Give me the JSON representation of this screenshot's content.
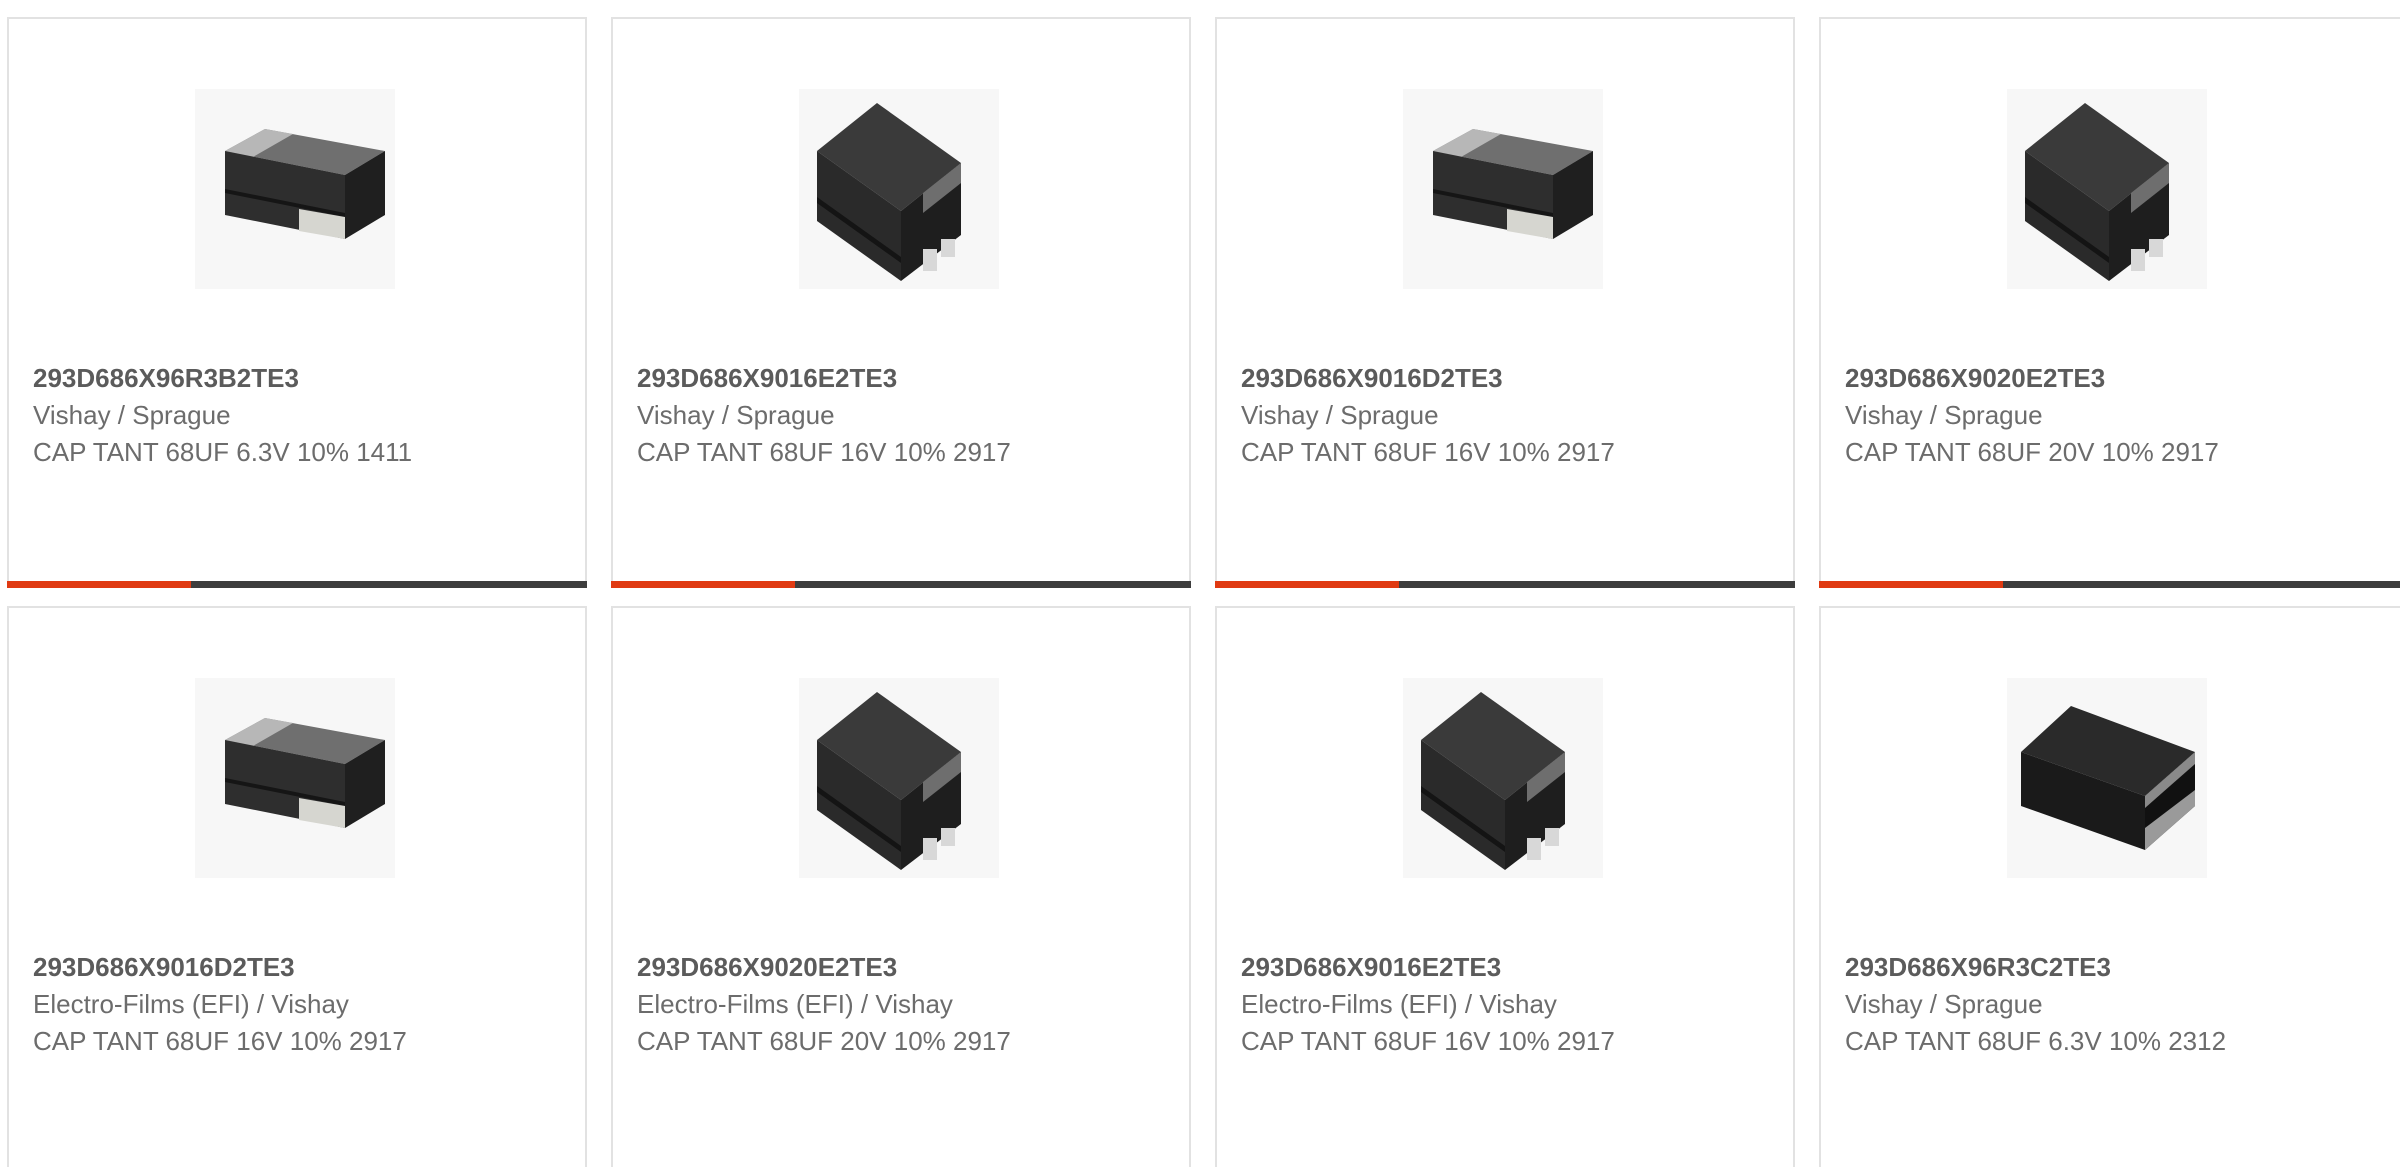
{
  "colors": {
    "accent": "#e03a12",
    "bar_dark": "#3d3d3d",
    "card_border": "#e2e2e2",
    "part_text": "#5b5b5b",
    "body_text": "#6c6c6c"
  },
  "products": [
    {
      "part_number": "293D686X96R3B2TE3",
      "manufacturer": "Vishay / Sprague",
      "description": "CAP TANT 68UF 6.3V 10% 1411",
      "image_icon": "tantalum-capacitor-flat-icon"
    },
    {
      "part_number": "293D686X9016E2TE3",
      "manufacturer": "Vishay / Sprague",
      "description": "CAP TANT 68UF 16V 10% 2917",
      "image_icon": "tantalum-capacitor-tall-icon"
    },
    {
      "part_number": "293D686X9016D2TE3",
      "manufacturer": "Vishay / Sprague",
      "description": "CAP TANT 68UF 16V 10% 2917",
      "image_icon": "tantalum-capacitor-flat-icon"
    },
    {
      "part_number": "293D686X9020E2TE3",
      "manufacturer": "Vishay / Sprague",
      "description": "CAP TANT 68UF 20V 10% 2917",
      "image_icon": "tantalum-capacitor-tall-icon"
    },
    {
      "part_number": "293D686X9016D2TE3",
      "manufacturer": "Electro-Films (EFI) / Vishay",
      "description": "CAP TANT 68UF 16V 10% 2917",
      "image_icon": "tantalum-capacitor-flat-icon"
    },
    {
      "part_number": "293D686X9020E2TE3",
      "manufacturer": "Electro-Films (EFI) / Vishay",
      "description": "CAP TANT 68UF 20V 10% 2917",
      "image_icon": "tantalum-capacitor-tall-icon"
    },
    {
      "part_number": "293D686X9016E2TE3",
      "manufacturer": "Electro-Films (EFI) / Vishay",
      "description": "CAP TANT 68UF 16V 10% 2917",
      "image_icon": "tantalum-capacitor-tall-icon"
    },
    {
      "part_number": "293D686X96R3C2TE3",
      "manufacturer": "Vishay / Sprague",
      "description": "CAP TANT 68UF 6.3V 10% 2312",
      "image_icon": "tantalum-capacitor-wide-icon"
    }
  ]
}
